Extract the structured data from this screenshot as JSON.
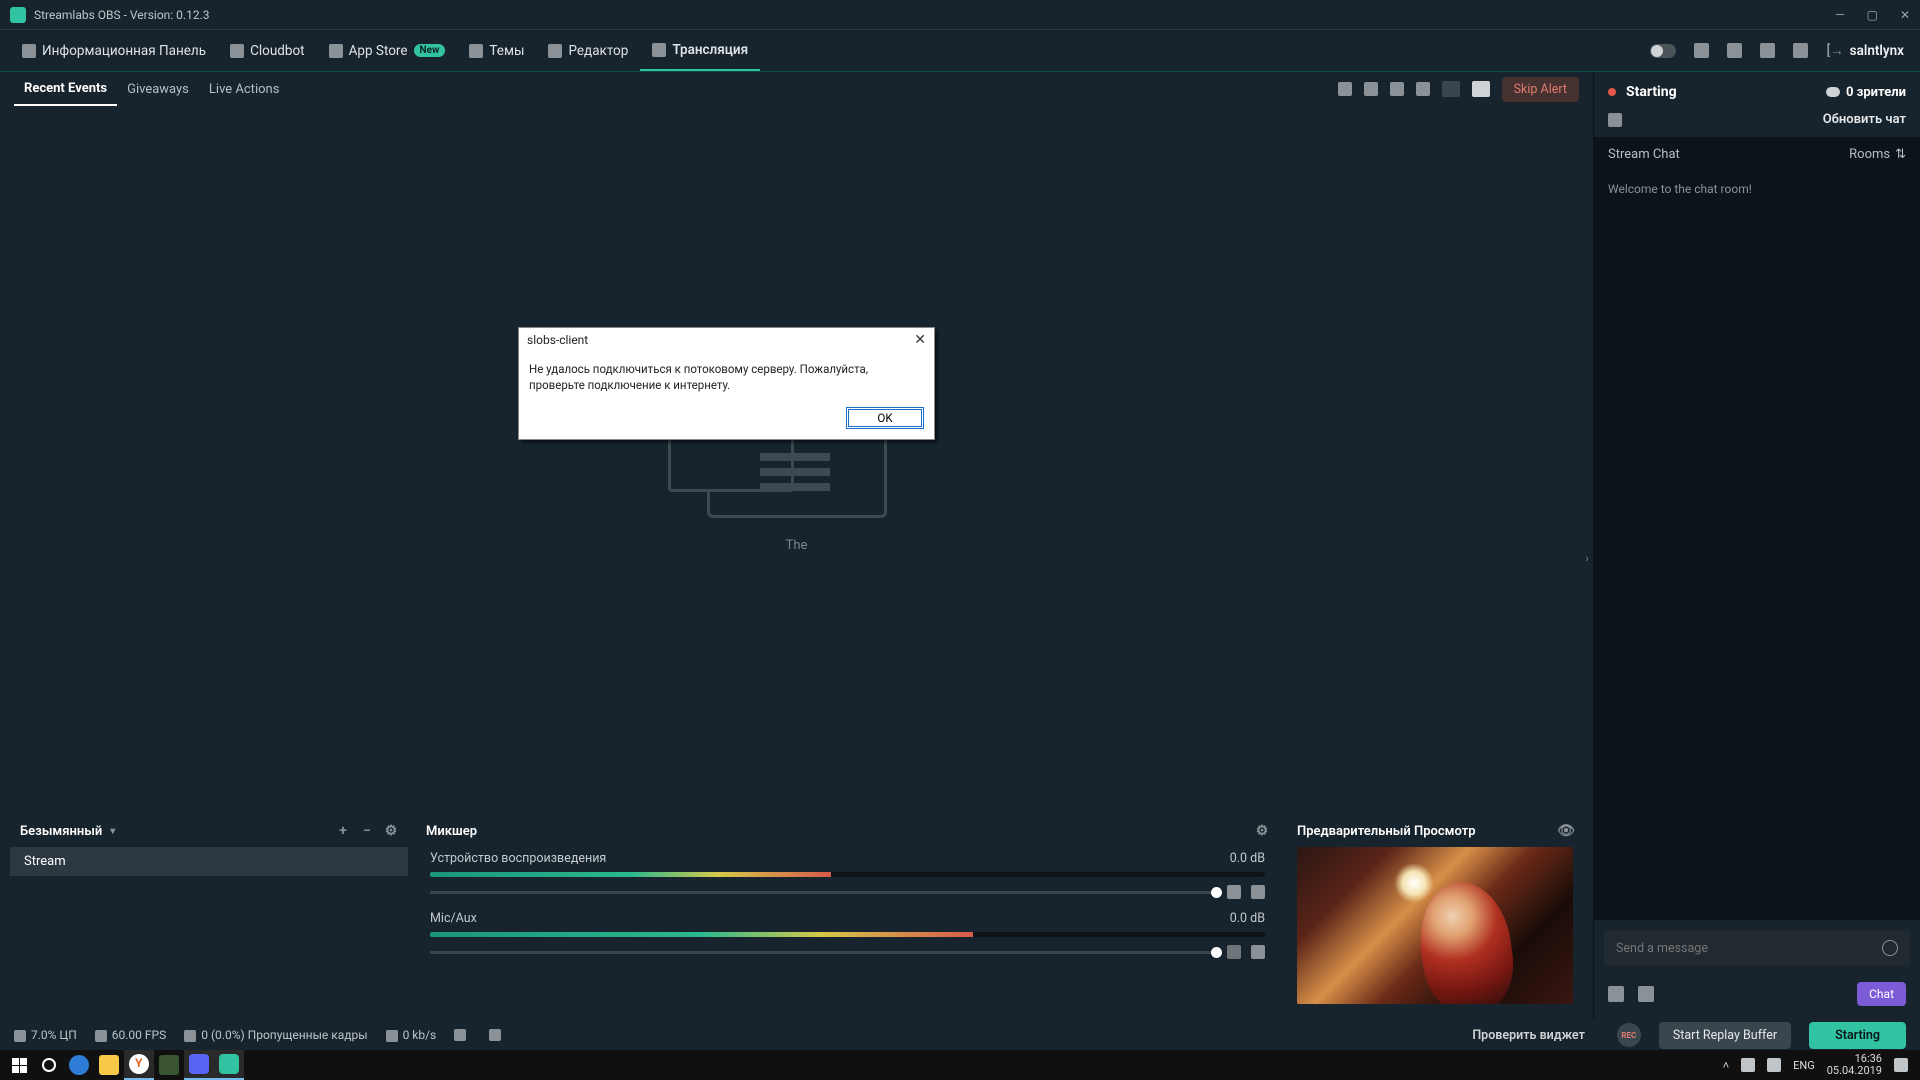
{
  "window_title": "Streamlabs OBS - Version: 0.12.3",
  "nav": {
    "items": [
      {
        "label": "Информационная Панель"
      },
      {
        "label": "Cloudbot"
      },
      {
        "label": "App Store",
        "badge": "New"
      },
      {
        "label": "Темы"
      },
      {
        "label": "Редактор"
      },
      {
        "label": "Трансляция"
      }
    ],
    "user": "salntlynx",
    "user_arrow": "[→"
  },
  "events": {
    "tabs": [
      "Recent Events",
      "Giveaways",
      "Live Actions"
    ],
    "skip": "Skip Alert",
    "placeholder": "The"
  },
  "scenes": {
    "title": "Безымянный",
    "items": [
      "Stream"
    ]
  },
  "mixer": {
    "title": "Микшер",
    "items": [
      {
        "name": "Устройство воспроизведения",
        "db": "0.0 dB",
        "muted": false
      },
      {
        "name": "Mic/Aux",
        "db": "0.0 dB",
        "muted": true
      }
    ]
  },
  "preview": {
    "title": "Предварительный Просмотр"
  },
  "status": {
    "cpu": "7.0% ЦП",
    "fps": "60.00 FPS",
    "dropped": "0 (0.0%) Пропущенные кадры",
    "bitrate": "0 kb/s",
    "check": "Проверить виджет",
    "rec": "REC",
    "replay": "Start Replay Buffer",
    "starting": "Starting"
  },
  "right": {
    "state": "Starting",
    "viewers": "0 зрители",
    "refresh": "Обновить чат",
    "chat_hdr": "Stream Chat",
    "rooms": "Rooms",
    "welcome": "Welcome to the chat room!",
    "placeholder": "Send a message",
    "chat_btn": "Chat"
  },
  "dialog": {
    "title": "slobs-client",
    "message": "Не удалось подключиться к потоковому серверу. Пожалуйста, проверьте подключение к интернету.",
    "ok": "OK"
  },
  "taskbar": {
    "lang": "ENG",
    "time": "16:36",
    "date": "05.04.2019"
  }
}
